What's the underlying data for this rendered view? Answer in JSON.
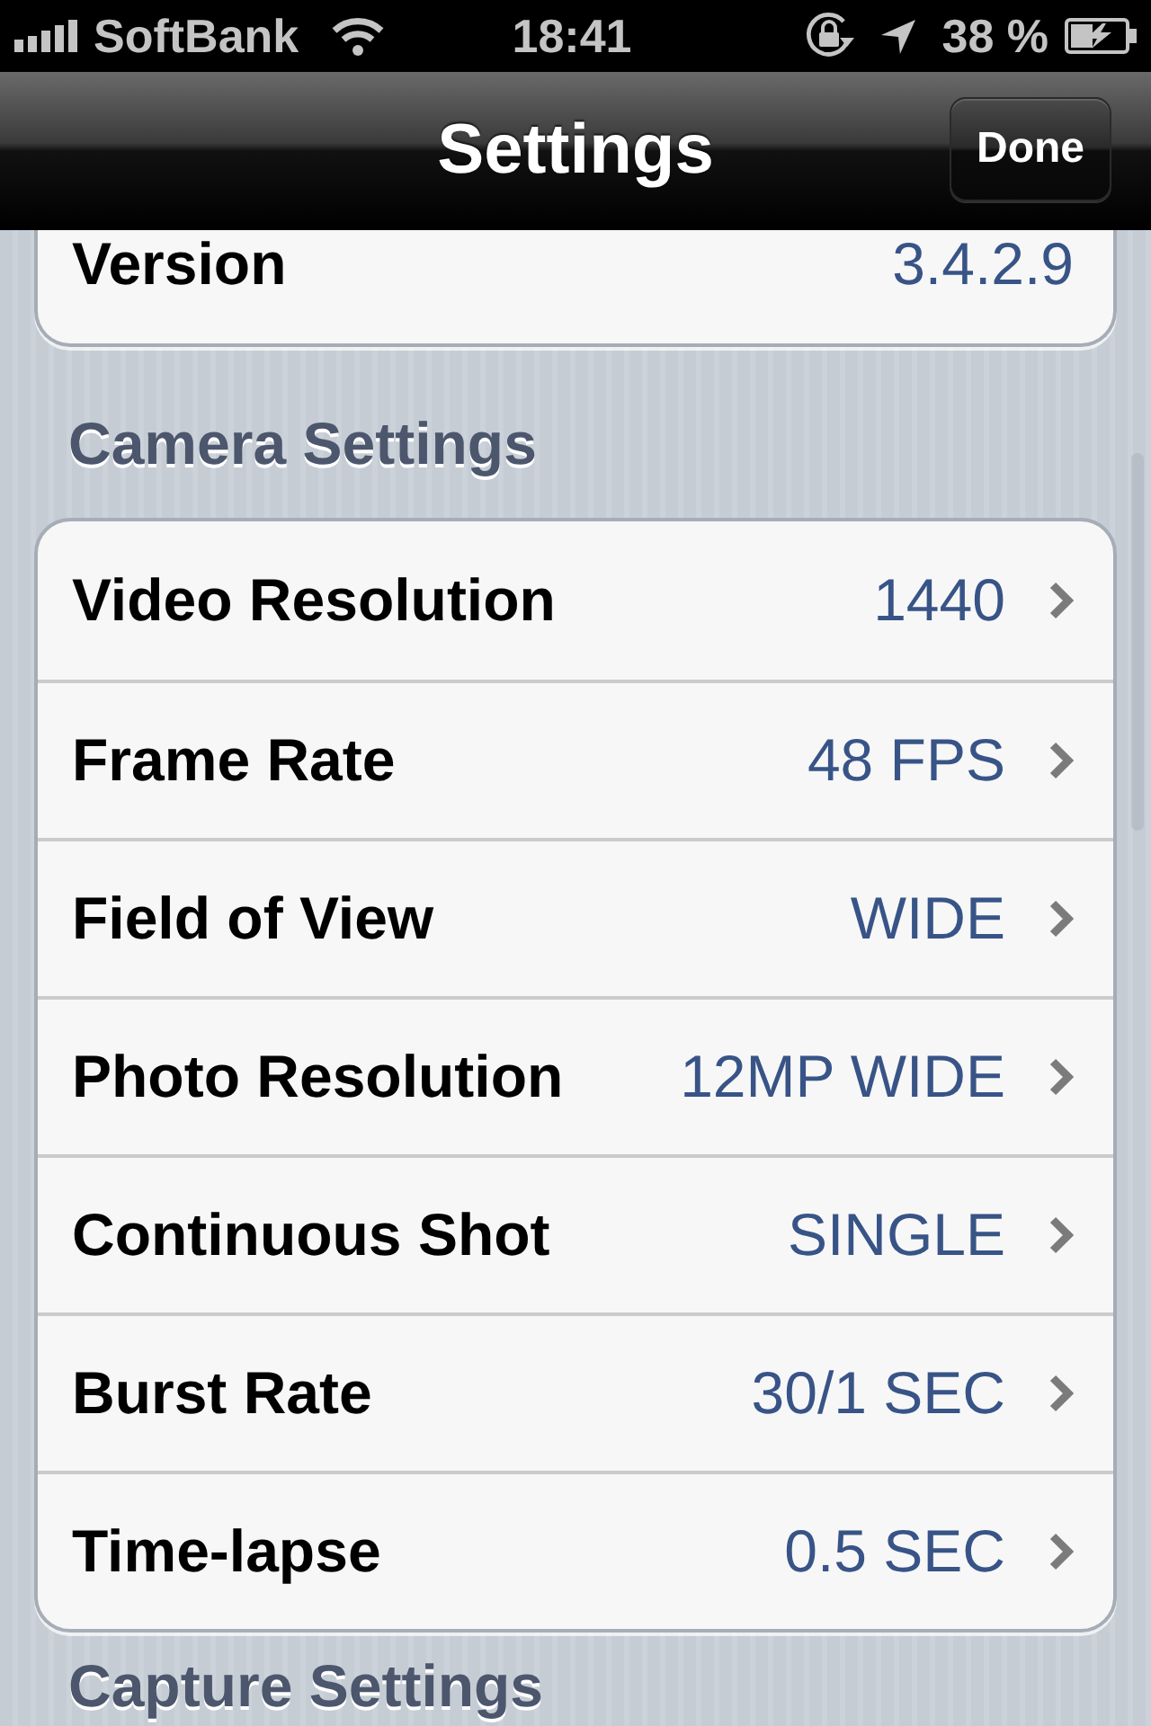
{
  "status_bar": {
    "carrier": "SoftBank",
    "time": "18:41",
    "battery": "38 %"
  },
  "nav_bar": {
    "title": "Settings",
    "done_button": "Done"
  },
  "sections": [
    {
      "rows": [
        {
          "kind": "info",
          "label": "Version",
          "value": "3.4.2.9"
        }
      ]
    },
    {
      "header": "Camera Settings",
      "rows": [
        {
          "kind": "disclosure",
          "label": "Video Resolution",
          "value": "1440"
        },
        {
          "kind": "disclosure",
          "label": "Frame Rate",
          "value": "48 FPS"
        },
        {
          "kind": "disclosure",
          "label": "Field of View",
          "value": "WIDE"
        },
        {
          "kind": "disclosure",
          "label": "Photo Resolution",
          "value": "12MP WIDE"
        },
        {
          "kind": "disclosure",
          "label": "Continuous Shot",
          "value": "SINGLE"
        },
        {
          "kind": "disclosure",
          "label": "Burst Rate",
          "value": "30/1 SEC"
        },
        {
          "kind": "disclosure",
          "label": "Time-lapse",
          "value": "0.5 SEC"
        }
      ]
    },
    {
      "header": "Capture Settings"
    }
  ]
}
